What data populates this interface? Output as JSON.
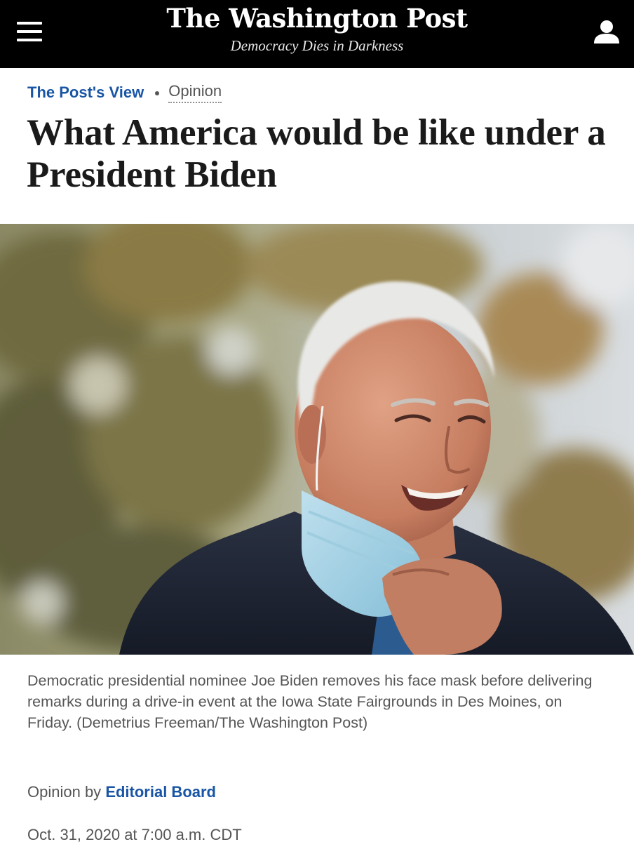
{
  "header": {
    "logo_text": "The Washington Post",
    "tagline": "Democracy Dies in Darkness",
    "menu_icon": "hamburger-menu-icon",
    "account_icon": "user-account-icon"
  },
  "kicker": {
    "section": "The Post's View",
    "label": "Opinion"
  },
  "article": {
    "headline": "What America would be like under a President Biden",
    "photo_alt": "Joe Biden smiling while removing a blue face mask, trees in the background",
    "caption": "Democratic presidential nominee Joe Biden removes his face mask before delivering remarks during a drive-in event at the Iowa State Fairgrounds in Des Moines, on Friday. (Demetrius Freeman/The Washington Post)",
    "byline_prefix": "Opinion by",
    "byline_author": "Editorial Board",
    "date": "Oct. 31, 2020 at 7:00 a.m. CDT"
  },
  "colors": {
    "topbar": "#000000",
    "link_blue": "#1955a5",
    "headline": "#1a1a1a",
    "secondary_text": "#555555"
  }
}
